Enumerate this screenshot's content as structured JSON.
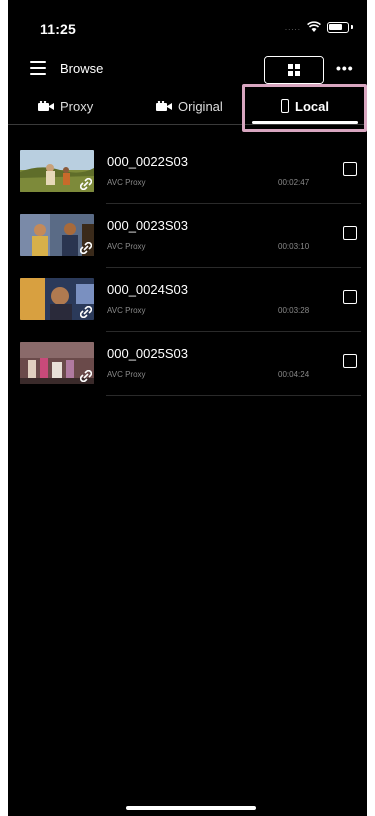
{
  "status": {
    "time": "11:25",
    "signal": "....."
  },
  "header": {
    "title": "Browse"
  },
  "tabs": [
    {
      "label": "Proxy",
      "active": false
    },
    {
      "label": "Original",
      "active": false
    },
    {
      "label": "Local",
      "active": true
    }
  ],
  "clips": [
    {
      "name": "000_0022S03",
      "format": "AVC Proxy",
      "duration": "00:02:47"
    },
    {
      "name": "000_0023S03",
      "format": "AVC Proxy",
      "duration": "00:03:10"
    },
    {
      "name": "000_0024S03",
      "format": "AVC Proxy",
      "duration": "00:03:28"
    },
    {
      "name": "000_0025S03",
      "format": "AVC Proxy",
      "duration": "00:04:24"
    }
  ],
  "colors": {
    "background": "#000000",
    "highlight": "#d8a6c0",
    "text": "#ffffff",
    "muted": "#8a8a8a"
  },
  "icons": [
    "menu-icon",
    "grid-view-icon",
    "list-view-icon",
    "more-icon",
    "camera-icon",
    "phone-icon",
    "link-icon",
    "wifi-icon",
    "battery-icon"
  ]
}
